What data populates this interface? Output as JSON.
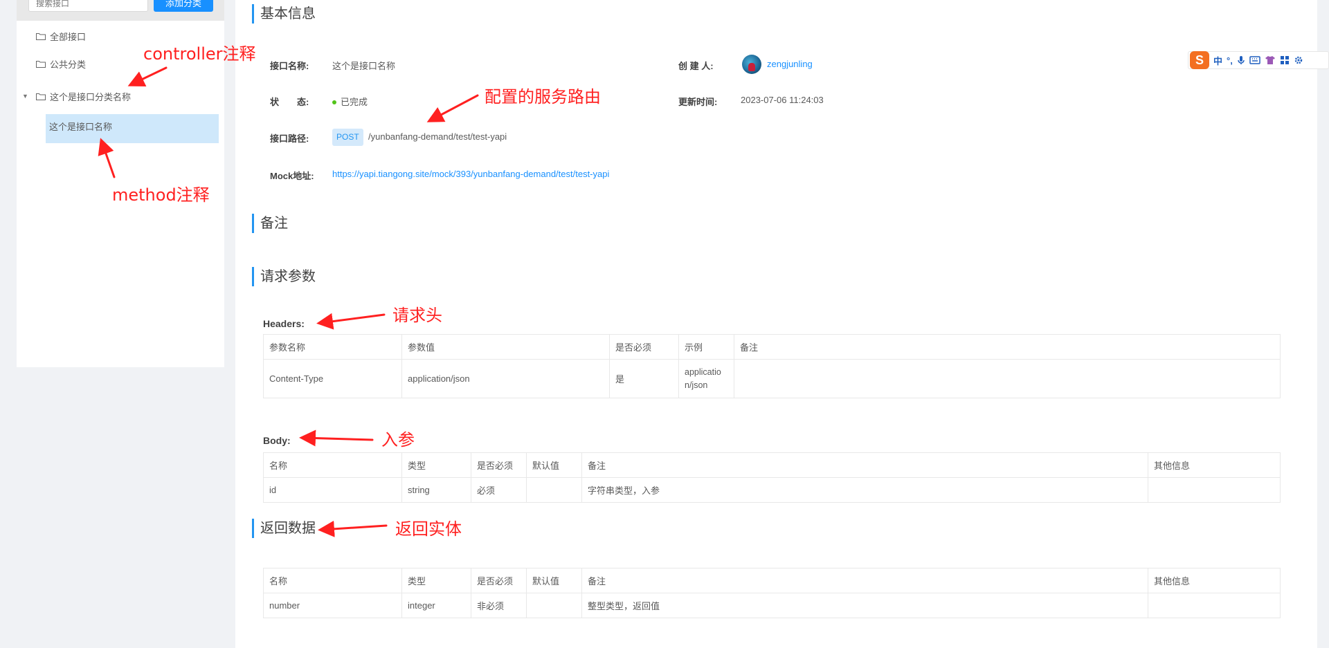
{
  "sidebar": {
    "search_placeholder": "搜索接口",
    "add_button": "添加分类",
    "items": [
      {
        "label": "全部接口"
      },
      {
        "label": "公共分类"
      },
      {
        "label": "这个是接口分类名称"
      }
    ],
    "selected_leaf": "这个是接口名称"
  },
  "basic_info": {
    "title": "基本信息",
    "name_label": "接口名称:",
    "name_value": "这个是接口名称",
    "creator_label": "创 建 人:",
    "creator_value": "zengjunling",
    "status_label": "状　　态:",
    "status_value": "已完成",
    "update_label": "更新时间:",
    "update_value": "2023-07-06 11:24:03",
    "path_label": "接口路径:",
    "method": "POST",
    "path_value": "/yunbanfang-demand/test/test-yapi",
    "mock_label": "Mock地址:",
    "mock_value": "https://yapi.tiangong.site/mock/393/yunbanfang-demand/test/test-yapi"
  },
  "remarks": {
    "title": "备注"
  },
  "request": {
    "title": "请求参数",
    "headers_label": "Headers:",
    "headers_columns": [
      "参数名称",
      "参数值",
      "是否必须",
      "示例",
      "备注"
    ],
    "headers_rows": [
      [
        "Content-Type",
        "application/json",
        "是",
        "application/json",
        ""
      ]
    ],
    "body_label": "Body:",
    "body_columns": [
      "名称",
      "类型",
      "是否必须",
      "默认值",
      "备注",
      "其他信息"
    ],
    "body_rows": [
      [
        "id",
        "string",
        "必须",
        "",
        "字符串类型，入参",
        ""
      ]
    ]
  },
  "response": {
    "title": "返回数据",
    "columns": [
      "名称",
      "类型",
      "是否必须",
      "默认值",
      "备注",
      "其他信息"
    ],
    "rows": [
      [
        "number",
        "integer",
        "非必须",
        "",
        "整型类型，返回值",
        ""
      ]
    ]
  },
  "annotations": {
    "controller": "controller注释",
    "method": "method注释",
    "route": "配置的服务路由",
    "headers": "请求头",
    "body": "入参",
    "response": "返回实体"
  },
  "ime": {
    "logo": "S",
    "mode": "中",
    "punct": "°,"
  },
  "colors": {
    "accent": "#2395f1",
    "annotation": "#ff2020",
    "status": "#52c41a",
    "selected": "#cfe8fb"
  }
}
